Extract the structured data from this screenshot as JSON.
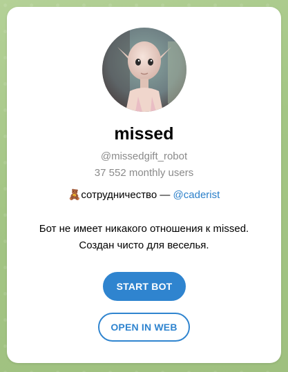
{
  "profile": {
    "name": "missed",
    "username": "@missedgift_robot",
    "monthly_users": "37 552 monthly users",
    "collab_emoji": "🧸",
    "collab_text": "сотрудничество — ",
    "collab_link": "@caderist",
    "description_line1": "Бот не имеет никакого отношения к missed.",
    "description_line2": "Создан чисто для веселья."
  },
  "actions": {
    "start_label": "START BOT",
    "web_label": "OPEN IN WEB"
  },
  "colors": {
    "accent": "#2f84cf",
    "link": "#2a7fc9",
    "background": "#a9c98b"
  }
}
